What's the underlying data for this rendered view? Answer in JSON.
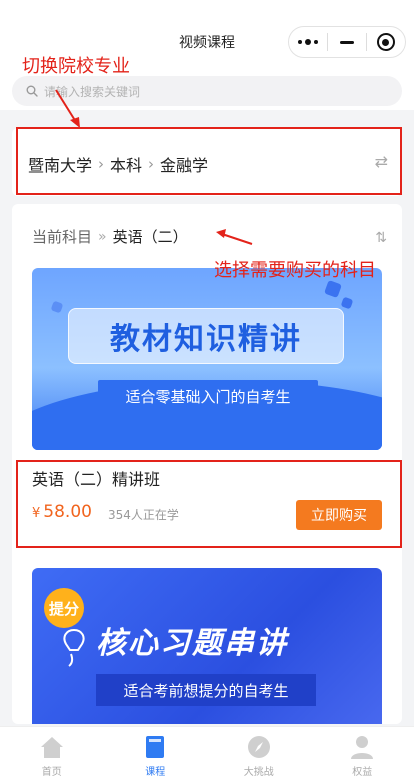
{
  "header": {
    "title": "视频课程",
    "capsule_menu_icon": "more-dots-icon",
    "capsule_minimize_icon": "minimize-icon",
    "capsule_close_icon": "target-close-icon"
  },
  "annotations": {
    "switch_school": "切换院校专业",
    "select_subject": "选择需要购买的科目"
  },
  "search": {
    "placeholder": "请输入搜索关键词"
  },
  "school": {
    "university": "暨南大学",
    "level": "本科",
    "major": "金融学",
    "chevron": "›",
    "swap_icon": "⇄"
  },
  "subject": {
    "label": "当前科目",
    "value": "英语（二）",
    "separator": "»",
    "sort_icon": "⇅"
  },
  "courses": [
    {
      "banner_title": "教材知识精讲",
      "banner_subtitle": "适合零基础入门的自考生",
      "title": "英语（二）精讲班",
      "currency": "¥",
      "price": "58.00",
      "learners": "354人正在学",
      "buy_label": "立即购买"
    },
    {
      "banner_tag": "提分",
      "banner_title": "核心习题串讲",
      "banner_subtitle": "适合考前想提分的自考生"
    }
  ],
  "tabbar": [
    {
      "label": "首页",
      "icon": "home-icon",
      "active": false
    },
    {
      "label": "课程",
      "icon": "book-icon",
      "active": true
    },
    {
      "label": "大挑战",
      "icon": "compass-icon",
      "active": false
    },
    {
      "label": "权益",
      "icon": "user-icon",
      "active": false
    }
  ],
  "colors": {
    "accent": "#2f7bf2",
    "price": "#f1641e",
    "buy_button": "#f47a1f",
    "annotation": "#e3231a"
  }
}
